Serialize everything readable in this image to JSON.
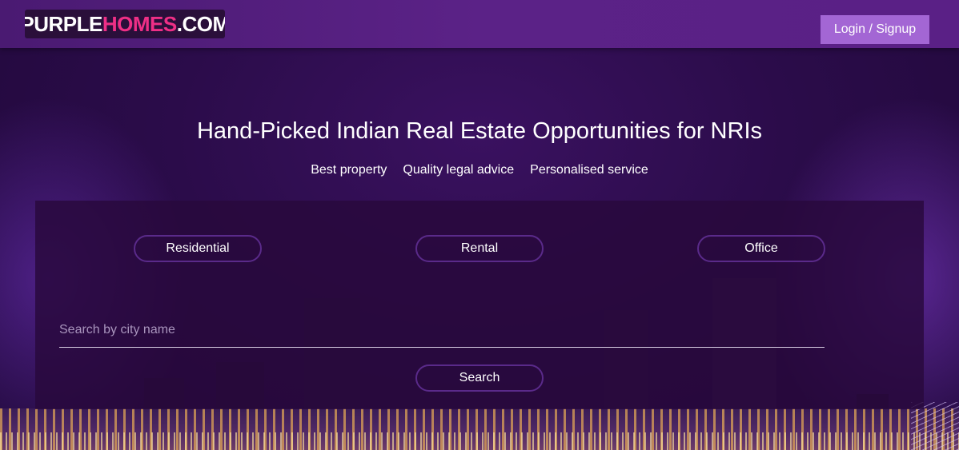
{
  "header": {
    "logo": {
      "part1": "PURPLE",
      "part2": "HOMES",
      "part3": ".COM"
    },
    "login_label": "Login / Signup"
  },
  "hero": {
    "title": "Hand-Picked Indian Real Estate Opportunities for NRIs",
    "taglines": [
      "Best property",
      "Quality legal advice",
      "Personalised service"
    ]
  },
  "search": {
    "property_types": [
      "Residential",
      "Rental",
      "Office"
    ],
    "placeholder": "Search by city name",
    "value": "",
    "button_label": "Search"
  },
  "colors": {
    "header_bg": "#5b2287",
    "accent": "#a366d4",
    "logo_pink": "#ee2f86",
    "panel_bg": "#28083c"
  }
}
